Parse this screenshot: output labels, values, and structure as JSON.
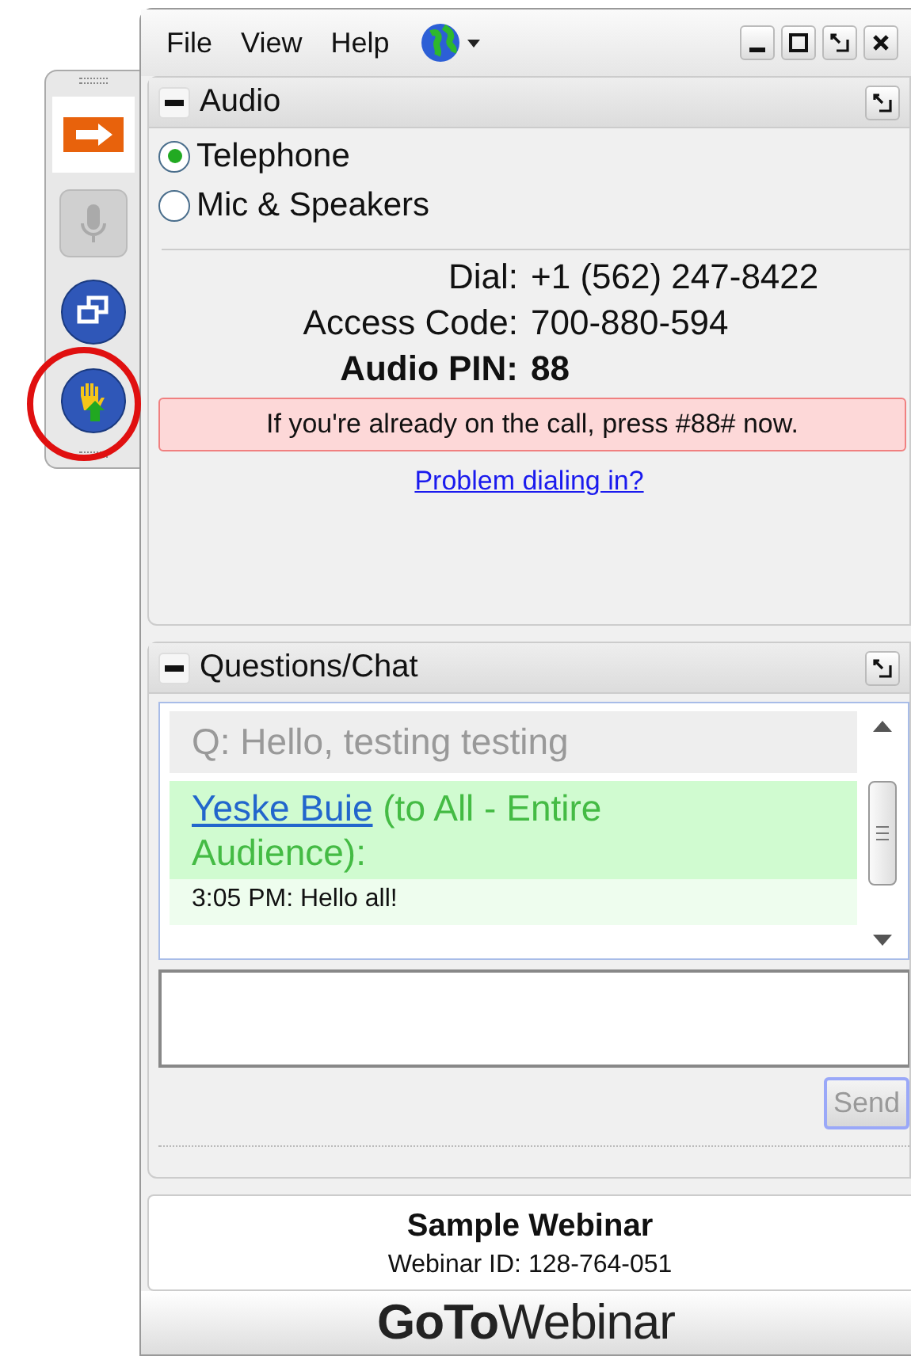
{
  "toolbar": [
    {
      "kind": "arrow",
      "disabled": false,
      "highlighted": false
    },
    {
      "kind": "mic",
      "disabled": true,
      "highlighted": false
    },
    {
      "kind": "window",
      "disabled": false,
      "highlighted": false
    },
    {
      "kind": "hand",
      "disabled": false,
      "highlighted": true
    }
  ],
  "menu": [
    {
      "label": "File"
    },
    {
      "label": "View"
    },
    {
      "label": "Help"
    }
  ],
  "audio": {
    "title": "Audio",
    "options": [
      {
        "label": "Telephone",
        "selected": true
      },
      {
        "label": "Mic & Speakers",
        "selected": false
      }
    ],
    "details": [
      {
        "label": "Dial:",
        "value": "+1 (562) 247-8422",
        "bold": false
      },
      {
        "label": "Access Code:",
        "value": "700-880-594",
        "bold": false
      },
      {
        "label": "Audio PIN:",
        "value": "88",
        "bold": true
      }
    ],
    "notice": "If you're already on the call, press #88# now.",
    "help_link": "Problem dialing in?"
  },
  "chat": {
    "title": "Questions/Chat",
    "question": "Q: Hello, testing testing",
    "message": {
      "sender": "Yeske Buie",
      "audience": "(to All - Entire Audience):",
      "text": "3:05 PM: Hello all!"
    },
    "send": "Send"
  },
  "webinar": {
    "name": "Sample Webinar",
    "id": "Webinar ID: 128-764-051"
  },
  "brand": "**GoTo**Webinar"
}
